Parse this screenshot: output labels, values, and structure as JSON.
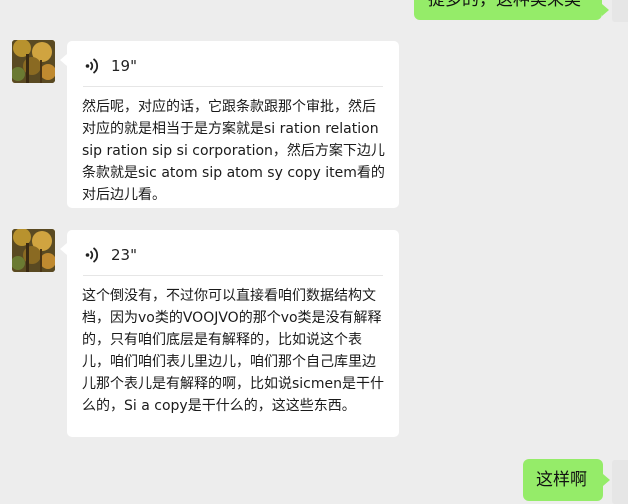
{
  "messages": [
    {
      "side": "right",
      "text": "提多的，这种类来类"
    },
    {
      "side": "left",
      "duration": "19\"",
      "transcript": "然后呢，对应的话，它跟条款跟那个审批，然后对应的就是相当于是方案就是si ration relation sip ration sip si corporation，然后方案下边儿条款就是sic atom sip atom sy copy item看的对后边儿看。"
    },
    {
      "side": "left",
      "duration": "23\"",
      "transcript": "这个倒没有，不过你可以直接看咱们数据结构文档，因为vo类的VOOJVO的那个vo类是没有解释的，只有咱们底层是有解释的，比如说这个表儿，咱们咱们表儿里边儿，咱们那个自己库里边儿那个表儿是有解释的啊，比如说sicmen是干什么的，Si a copy是干什么的，这这些东西。"
    },
    {
      "side": "right",
      "text": "这样啊"
    }
  ],
  "colors": {
    "background": "#ededed",
    "self_bubble": "#95ec69",
    "other_bubble": "#ffffff"
  }
}
